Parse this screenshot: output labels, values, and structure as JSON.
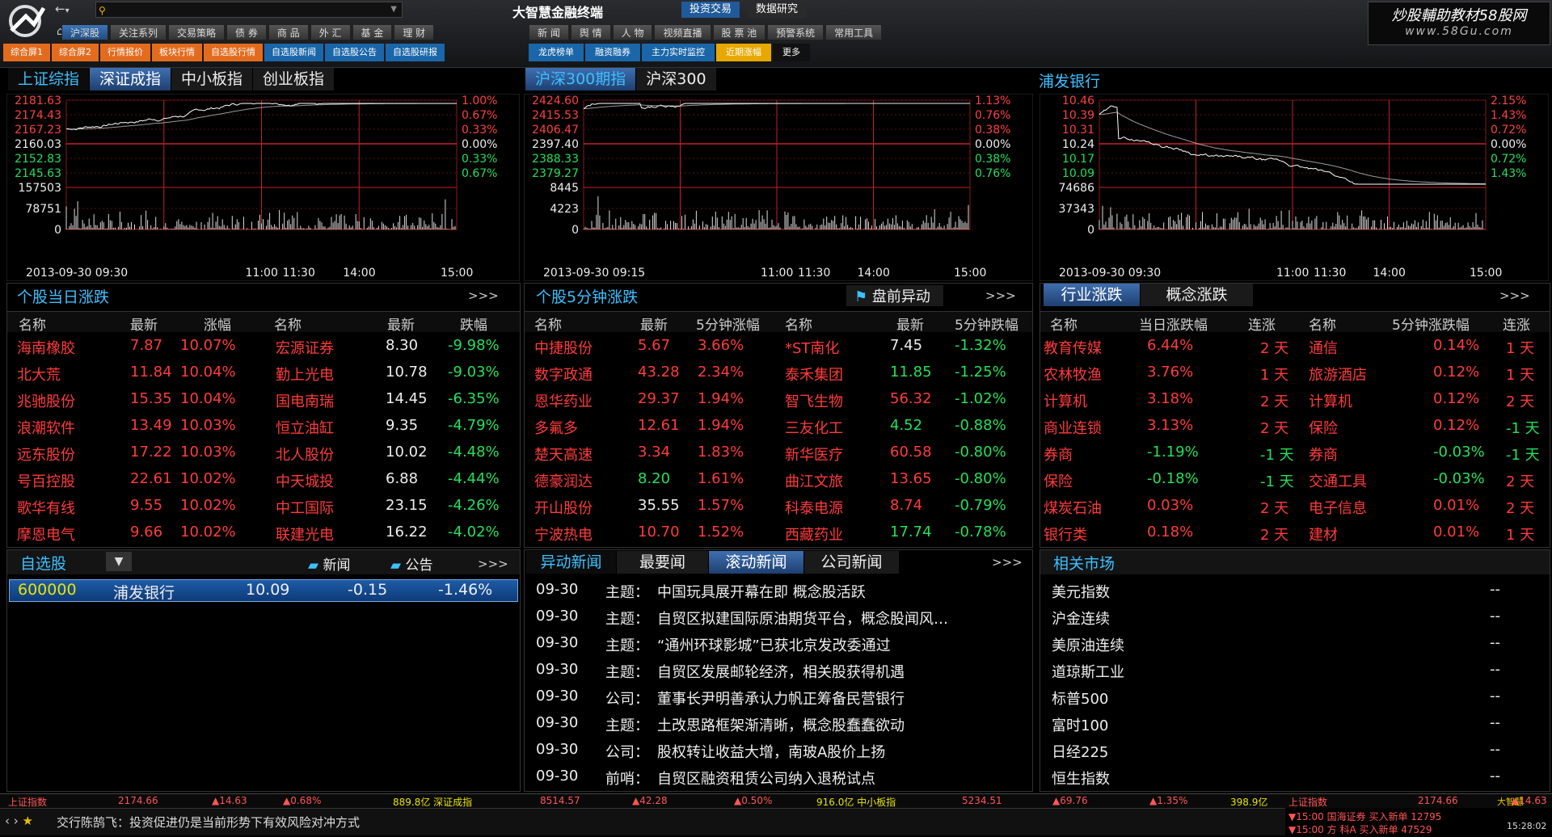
{
  "app": {
    "title": "大智慧金融终端",
    "mode_tabs": [
      "投资交易",
      "数据研究"
    ],
    "search_placeholder": "",
    "nav_back": "←",
    "nav_dd": "▾"
  },
  "menu1": [
    "沪深股",
    "关注系列",
    "交易策略",
    "债 券",
    "商 品",
    "外 汇",
    "基 金",
    "理 财"
  ],
  "menu2": [
    "新 闻",
    "舆 情",
    "人 物",
    "视频直播",
    "股 票 池",
    "预警系统",
    "常用工具"
  ],
  "sub1": [
    "综合屏1",
    "综合屏2",
    "行情报价",
    "板块行情",
    "自选股行情",
    "自选股新闻",
    "自选股公告",
    "自选股研报"
  ],
  "sub2": [
    "龙虎榜单",
    "融资融券",
    "主力实时监控",
    "近期涨幅",
    "更多"
  ],
  "watermark": {
    "line1": "炒股輔助教材58股网",
    "line2": "www.58Gu.com"
  },
  "colors": {
    "up": "#ff3b3b",
    "down": "#22e05a",
    "accent": "#3cc0ff",
    "active_tab": "#3f6fb0"
  },
  "panels": {
    "index_tabs": [
      "上证综指",
      "深证成指",
      "中小板指",
      "创业板指"
    ],
    "hs300_tabs": [
      "沪深300期指",
      "沪深300"
    ],
    "stock_title": "浦发银行",
    "chart1": {
      "left_ticks": [
        "2181.63",
        "2174.43",
        "2167.23",
        "2160.03",
        "2152.83",
        "2145.63",
        "157503",
        "78751",
        "0"
      ],
      "right_ticks": [
        "1.00%",
        "0.67%",
        "0.33%",
        "0.00%",
        "0.33%",
        "0.67%"
      ],
      "x_labels": [
        "2013-09-30 09:30",
        "11:00",
        "11:30",
        "14:00",
        "15:00"
      ]
    },
    "chart2": {
      "left_ticks": [
        "2424.60",
        "2415.53",
        "2406.47",
        "2397.40",
        "2388.33",
        "2379.27",
        "8445",
        "4223",
        "0"
      ],
      "right_ticks": [
        "1.13%",
        "0.76%",
        "0.38%",
        "0.00%",
        "0.38%",
        "0.76%"
      ],
      "x_labels": [
        "2013-09-30 09:15",
        "11:00",
        "11:30",
        "14:00",
        "15:00"
      ]
    },
    "chart3": {
      "left_ticks": [
        "10.46",
        "10.39",
        "10.31",
        "10.24",
        "10.17",
        "10.09",
        "74686",
        "37343",
        "0"
      ],
      "right_ticks": [
        "2.15%",
        "1.43%",
        "0.72%",
        "0.00%",
        "0.72%",
        "1.43%"
      ],
      "x_labels": [
        "2013-09-30 09:30",
        "11:00",
        "11:30",
        "14:00",
        "15:00"
      ]
    }
  },
  "daily": {
    "title": "个股当日涨跌",
    "more": ">>>",
    "headers": [
      "名称",
      "最新",
      "涨幅",
      "名称",
      "最新",
      "跌幅"
    ],
    "rows": [
      [
        "海南橡胶",
        "7.87",
        "10.07%",
        "宏源证券",
        "8.30",
        "-9.98%"
      ],
      [
        "北大荒",
        "11.84",
        "10.04%",
        "勤上光电",
        "10.78",
        "-9.03%"
      ],
      [
        "兆驰股份",
        "15.35",
        "10.04%",
        "国电南瑞",
        "14.45",
        "-6.35%"
      ],
      [
        "浪潮软件",
        "13.49",
        "10.03%",
        "恒立油缸",
        "9.35",
        "-4.79%"
      ],
      [
        "远东股份",
        "17.22",
        "10.03%",
        "北人股份",
        "10.02",
        "-4.48%"
      ],
      [
        "号百控股",
        "22.61",
        "10.02%",
        "中天城投",
        "6.88",
        "-4.44%"
      ],
      [
        "歌华有线",
        "9.55",
        "10.02%",
        "中工国际",
        "23.15",
        "-4.26%"
      ],
      [
        "摩恩电气",
        "9.66",
        "10.02%",
        "联建光电",
        "16.22",
        "-4.02%"
      ]
    ]
  },
  "five": {
    "title": "个股5分钟涨跌",
    "alert": "盘前异动",
    "more": ">>>",
    "headers": [
      "名称",
      "最新",
      "5分钟涨幅",
      "名称",
      "最新",
      "5分钟跌幅"
    ],
    "rows": [
      [
        "中捷股份",
        "5.67",
        "3.66%",
        "*ST南化",
        "7.45",
        "-1.32%"
      ],
      [
        "数字政通",
        "43.28",
        "2.34%",
        "泰禾集团",
        "11.85",
        "-1.25%"
      ],
      [
        "恩华药业",
        "29.37",
        "1.94%",
        "智飞生物",
        "56.32",
        "-1.02%"
      ],
      [
        "多氟多",
        "12.61",
        "1.94%",
        "三友化工",
        "4.52",
        "-0.88%"
      ],
      [
        "楚天高速",
        "3.34",
        "1.83%",
        "新华医疗",
        "60.58",
        "-0.80%"
      ],
      [
        "德豪润达",
        "8.20",
        "1.61%",
        "曲江文旅",
        "13.65",
        "-0.80%"
      ],
      [
        "开山股份",
        "35.55",
        "1.57%",
        "科泰电源",
        "8.74",
        "-0.79%"
      ],
      [
        "宁波热电",
        "10.70",
        "1.52%",
        "西藏药业",
        "17.74",
        "-0.78%"
      ]
    ]
  },
  "industry": {
    "tabs": [
      "行业涨跌",
      "概念涨跌"
    ],
    "more": ">>>",
    "headers": [
      "名称",
      "当日涨跌幅",
      "连涨",
      "名称",
      "5分钟涨跌幅",
      "连涨"
    ],
    "rows": [
      [
        "教育传媒",
        "6.44%",
        "2 天",
        "通信",
        "0.14%",
        "1 天"
      ],
      [
        "农林牧渔",
        "3.76%",
        "1 天",
        "旅游酒店",
        "0.12%",
        "1 天"
      ],
      [
        "计算机",
        "3.18%",
        "2 天",
        "计算机",
        "0.12%",
        "2 天"
      ],
      [
        "商业连锁",
        "3.13%",
        "2 天",
        "保险",
        "0.12%",
        "-1 天"
      ],
      [
        "券商",
        "-1.19%",
        "-1 天",
        "券商",
        "-0.03%",
        "-1 天"
      ],
      [
        "保险",
        "-0.18%",
        "-1 天",
        "交通工具",
        "-0.03%",
        "2 天"
      ],
      [
        "煤炭石油",
        "0.03%",
        "2 天",
        "电子信息",
        "0.01%",
        "2 天"
      ],
      [
        "银行类",
        "0.18%",
        "2 天",
        "建材",
        "0.01%",
        "1 天"
      ]
    ]
  },
  "watch": {
    "title": "自选股",
    "news": "新闻",
    "notice": "公告",
    "more": ">>>",
    "row": [
      "600000",
      "浦发银行",
      "10.09",
      "-0.15",
      "-1.46%"
    ]
  },
  "news": {
    "tabs": [
      "异动新闻",
      "最要闻",
      "滚动新闻",
      "公司新闻"
    ],
    "more": ">>>",
    "rows": [
      [
        "09-30",
        "主题：",
        "中国玩具展开幕在即 概念股活跃"
      ],
      [
        "09-30",
        "主题：",
        "自贸区拟建国际原油期货平台，概念股闻风…"
      ],
      [
        "09-30",
        "主题：",
        "“通州环球影城”已获北京发改委通过"
      ],
      [
        "09-30",
        "主题：",
        "自贸区发展邮轮经济，相关股获得机遇"
      ],
      [
        "09-30",
        "公司：",
        "董事长尹明善承认力帆正筹备民营银行"
      ],
      [
        "09-30",
        "主题：",
        "土改思路框架渐清晰，概念股蠢蠢欲动"
      ],
      [
        "09-30",
        "公司：",
        "股权转让收益大增，南玻A股价上扬"
      ],
      [
        "09-30",
        "前哨：",
        "自贸区融资租赁公司纳入退税试点"
      ]
    ]
  },
  "related": {
    "title": "相关市场",
    "rows": [
      [
        "美元指数",
        "--"
      ],
      [
        "沪金连续",
        "--"
      ],
      [
        "美原油连续",
        "--"
      ],
      [
        "道琼斯工业",
        "--"
      ],
      [
        "标普500",
        "--"
      ],
      [
        "富时100",
        "--"
      ],
      [
        "日经225",
        "--"
      ],
      [
        "恒生指数",
        "--"
      ]
    ]
  },
  "statusbar": [
    {
      "t": "上证指数",
      "c": "#ff5555"
    },
    {
      "t": "2174.66",
      "c": "#ff5555"
    },
    {
      "t": "▲14.63",
      "c": "#ff5555"
    },
    {
      "t": "▲0.68%",
      "c": "#ff5555"
    },
    {
      "t": "889.8亿 深证成指",
      "c": "#e8e400"
    },
    {
      "t": "8514.57",
      "c": "#ff5555"
    },
    {
      "t": "▲42.28",
      "c": "#ff5555"
    },
    {
      "t": "▲0.50%",
      "c": "#ff5555"
    },
    {
      "t": "916.0亿 中小板指",
      "c": "#e8e400"
    },
    {
      "t": "5234.51",
      "c": "#ff5555"
    },
    {
      "t": "▲69.76",
      "c": "#ff5555"
    },
    {
      "t": "▲1.35%",
      "c": "#ff5555"
    },
    {
      "t": "398.9亿",
      "c": "#e8e400"
    },
    {
      "t": "上证指数",
      "c": "#ff5555"
    },
    {
      "t": "2174.66",
      "c": "#ff5555"
    },
    {
      "t": "▲14.63",
      "c": "#ff5555"
    }
  ],
  "ticker": {
    "text": "交行陈鹄飞：投资促进仍是当前形势下有效风险对冲方式",
    "right1": "▼15:00 国海证券 买入新单 12795",
    "right2": "▼15:00 方 科A 买入新单 47529",
    "brand": "大智慧",
    "time": "15:28:02"
  }
}
